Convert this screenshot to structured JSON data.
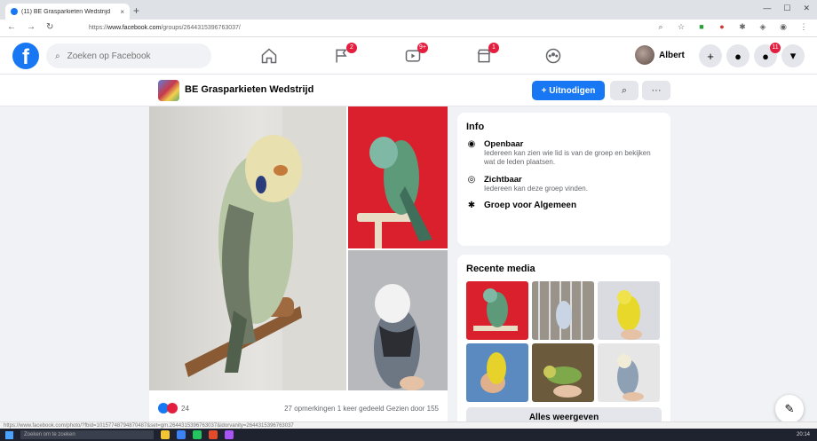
{
  "browser": {
    "tab_title": "(11) BE Grasparkieten Wedstrijd",
    "tab_close": "×",
    "new_tab": "+",
    "url_prefix": "https://",
    "url_domain": "www.facebook.com",
    "url_path": "/groups/2644315396763037/",
    "nav": {
      "back": "←",
      "forward": "→",
      "reload": "↻"
    },
    "window": {
      "min": "—",
      "max": "☐",
      "close": "✕"
    }
  },
  "header": {
    "logo": "f",
    "search_placeholder": "Zoeken op Facebook",
    "badges": {
      "pages": "2",
      "watch": "9+",
      "marketplace": "1"
    },
    "user_name": "Albert",
    "notif_badge": "11",
    "plus": "+",
    "messenger": "●",
    "bell": "🔔",
    "menu": "▾"
  },
  "group": {
    "name": "BE Grasparkieten Wedstrijd",
    "invite_label": "+ Uitnodigen",
    "search_icon": "⌕",
    "more": "···"
  },
  "post": {
    "reaction_count": "24",
    "stats": "27 opmerkingen  1 keer gedeeld  Gezien door 155"
  },
  "info": {
    "title": "Info",
    "rows": [
      {
        "title": "Openbaar",
        "desc": "Iedereen kan zien wie lid is van de groep en bekijken wat de leden plaatsen.",
        "icon": "globe-icon"
      },
      {
        "title": "Zichtbaar",
        "desc": "Iedereen kan deze groep vinden.",
        "icon": "eye-icon"
      },
      {
        "title": "Groep voor Algemeen",
        "desc": "",
        "icon": "group-icon"
      }
    ]
  },
  "media": {
    "title": "Recente media",
    "all_label": "Alles weergeven"
  },
  "statusbar_url": "https://www.facebook.com/photo/?fbid=10157748794870487&set=gm.2644315396763037&idorvanity=2644315396763037",
  "taskbar": {
    "search": "Zoeken om te zoeken",
    "time": "20:14"
  },
  "colors": {
    "brand": "#1877f2",
    "badge": "#e41e3f",
    "page_bg": "#f0f2f5"
  }
}
